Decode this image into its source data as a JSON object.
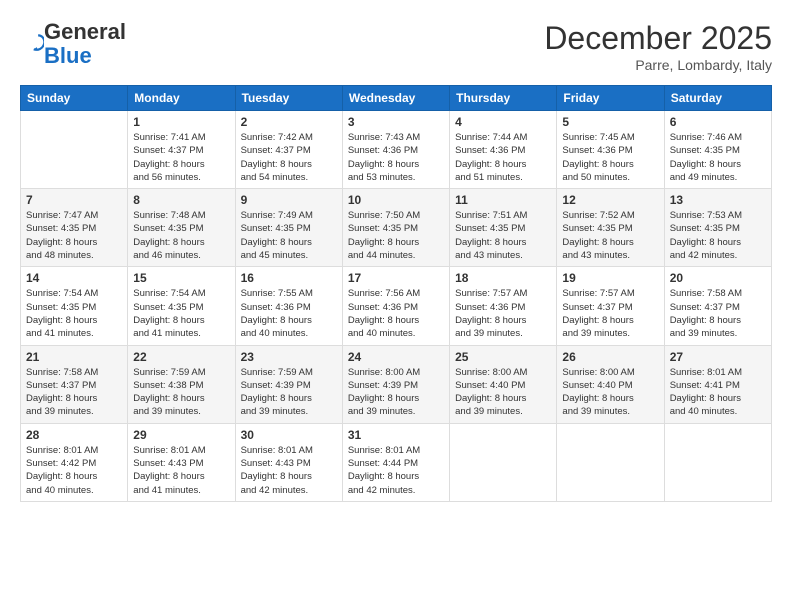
{
  "logo": {
    "general": "General",
    "blue": "Blue"
  },
  "header": {
    "month": "December 2025",
    "location": "Parre, Lombardy, Italy"
  },
  "weekdays": [
    "Sunday",
    "Monday",
    "Tuesday",
    "Wednesday",
    "Thursday",
    "Friday",
    "Saturday"
  ],
  "weeks": [
    [
      {
        "day": "",
        "info": ""
      },
      {
        "day": "1",
        "info": "Sunrise: 7:41 AM\nSunset: 4:37 PM\nDaylight: 8 hours\nand 56 minutes."
      },
      {
        "day": "2",
        "info": "Sunrise: 7:42 AM\nSunset: 4:37 PM\nDaylight: 8 hours\nand 54 minutes."
      },
      {
        "day": "3",
        "info": "Sunrise: 7:43 AM\nSunset: 4:36 PM\nDaylight: 8 hours\nand 53 minutes."
      },
      {
        "day": "4",
        "info": "Sunrise: 7:44 AM\nSunset: 4:36 PM\nDaylight: 8 hours\nand 51 minutes."
      },
      {
        "day": "5",
        "info": "Sunrise: 7:45 AM\nSunset: 4:36 PM\nDaylight: 8 hours\nand 50 minutes."
      },
      {
        "day": "6",
        "info": "Sunrise: 7:46 AM\nSunset: 4:35 PM\nDaylight: 8 hours\nand 49 minutes."
      }
    ],
    [
      {
        "day": "7",
        "info": "Sunrise: 7:47 AM\nSunset: 4:35 PM\nDaylight: 8 hours\nand 48 minutes."
      },
      {
        "day": "8",
        "info": "Sunrise: 7:48 AM\nSunset: 4:35 PM\nDaylight: 8 hours\nand 46 minutes."
      },
      {
        "day": "9",
        "info": "Sunrise: 7:49 AM\nSunset: 4:35 PM\nDaylight: 8 hours\nand 45 minutes."
      },
      {
        "day": "10",
        "info": "Sunrise: 7:50 AM\nSunset: 4:35 PM\nDaylight: 8 hours\nand 44 minutes."
      },
      {
        "day": "11",
        "info": "Sunrise: 7:51 AM\nSunset: 4:35 PM\nDaylight: 8 hours\nand 43 minutes."
      },
      {
        "day": "12",
        "info": "Sunrise: 7:52 AM\nSunset: 4:35 PM\nDaylight: 8 hours\nand 43 minutes."
      },
      {
        "day": "13",
        "info": "Sunrise: 7:53 AM\nSunset: 4:35 PM\nDaylight: 8 hours\nand 42 minutes."
      }
    ],
    [
      {
        "day": "14",
        "info": "Sunrise: 7:54 AM\nSunset: 4:35 PM\nDaylight: 8 hours\nand 41 minutes."
      },
      {
        "day": "15",
        "info": "Sunrise: 7:54 AM\nSunset: 4:35 PM\nDaylight: 8 hours\nand 41 minutes."
      },
      {
        "day": "16",
        "info": "Sunrise: 7:55 AM\nSunset: 4:36 PM\nDaylight: 8 hours\nand 40 minutes."
      },
      {
        "day": "17",
        "info": "Sunrise: 7:56 AM\nSunset: 4:36 PM\nDaylight: 8 hours\nand 40 minutes."
      },
      {
        "day": "18",
        "info": "Sunrise: 7:57 AM\nSunset: 4:36 PM\nDaylight: 8 hours\nand 39 minutes."
      },
      {
        "day": "19",
        "info": "Sunrise: 7:57 AM\nSunset: 4:37 PM\nDaylight: 8 hours\nand 39 minutes."
      },
      {
        "day": "20",
        "info": "Sunrise: 7:58 AM\nSunset: 4:37 PM\nDaylight: 8 hours\nand 39 minutes."
      }
    ],
    [
      {
        "day": "21",
        "info": "Sunrise: 7:58 AM\nSunset: 4:37 PM\nDaylight: 8 hours\nand 39 minutes."
      },
      {
        "day": "22",
        "info": "Sunrise: 7:59 AM\nSunset: 4:38 PM\nDaylight: 8 hours\nand 39 minutes."
      },
      {
        "day": "23",
        "info": "Sunrise: 7:59 AM\nSunset: 4:39 PM\nDaylight: 8 hours\nand 39 minutes."
      },
      {
        "day": "24",
        "info": "Sunrise: 8:00 AM\nSunset: 4:39 PM\nDaylight: 8 hours\nand 39 minutes."
      },
      {
        "day": "25",
        "info": "Sunrise: 8:00 AM\nSunset: 4:40 PM\nDaylight: 8 hours\nand 39 minutes."
      },
      {
        "day": "26",
        "info": "Sunrise: 8:00 AM\nSunset: 4:40 PM\nDaylight: 8 hours\nand 39 minutes."
      },
      {
        "day": "27",
        "info": "Sunrise: 8:01 AM\nSunset: 4:41 PM\nDaylight: 8 hours\nand 40 minutes."
      }
    ],
    [
      {
        "day": "28",
        "info": "Sunrise: 8:01 AM\nSunset: 4:42 PM\nDaylight: 8 hours\nand 40 minutes."
      },
      {
        "day": "29",
        "info": "Sunrise: 8:01 AM\nSunset: 4:43 PM\nDaylight: 8 hours\nand 41 minutes."
      },
      {
        "day": "30",
        "info": "Sunrise: 8:01 AM\nSunset: 4:43 PM\nDaylight: 8 hours\nand 42 minutes."
      },
      {
        "day": "31",
        "info": "Sunrise: 8:01 AM\nSunset: 4:44 PM\nDaylight: 8 hours\nand 42 minutes."
      },
      {
        "day": "",
        "info": ""
      },
      {
        "day": "",
        "info": ""
      },
      {
        "day": "",
        "info": ""
      }
    ]
  ]
}
